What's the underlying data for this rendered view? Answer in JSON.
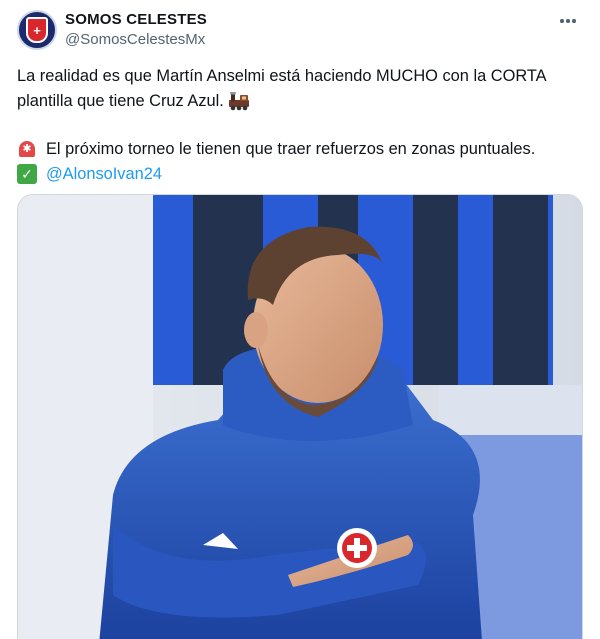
{
  "author": {
    "display_name": "SOMOS CELESTES",
    "handle": "@SomosCelestesMx",
    "avatar_icon": "cruz-azul-crest-icon"
  },
  "actions": {
    "more_icon": "more-dots-icon"
  },
  "tweet": {
    "line1": "La realidad es que Martín Anselmi está haciendo MUCHO con la CORTA",
    "line2": "plantilla que tiene Cruz Azul.",
    "line3": "El próximo torneo le tienen que traer refuerzos en zonas puntuales.",
    "mention": "@AlonsoIvan24",
    "emojis": [
      "train-icon",
      "siren-icon",
      "check-icon"
    ]
  },
  "media": {
    "icon": "photo-coach-in-blue-jacket"
  },
  "colors": {
    "accent": "#1d9bf0",
    "brand_blue": "#1b3f9c",
    "crest_red": "#d9272e"
  }
}
